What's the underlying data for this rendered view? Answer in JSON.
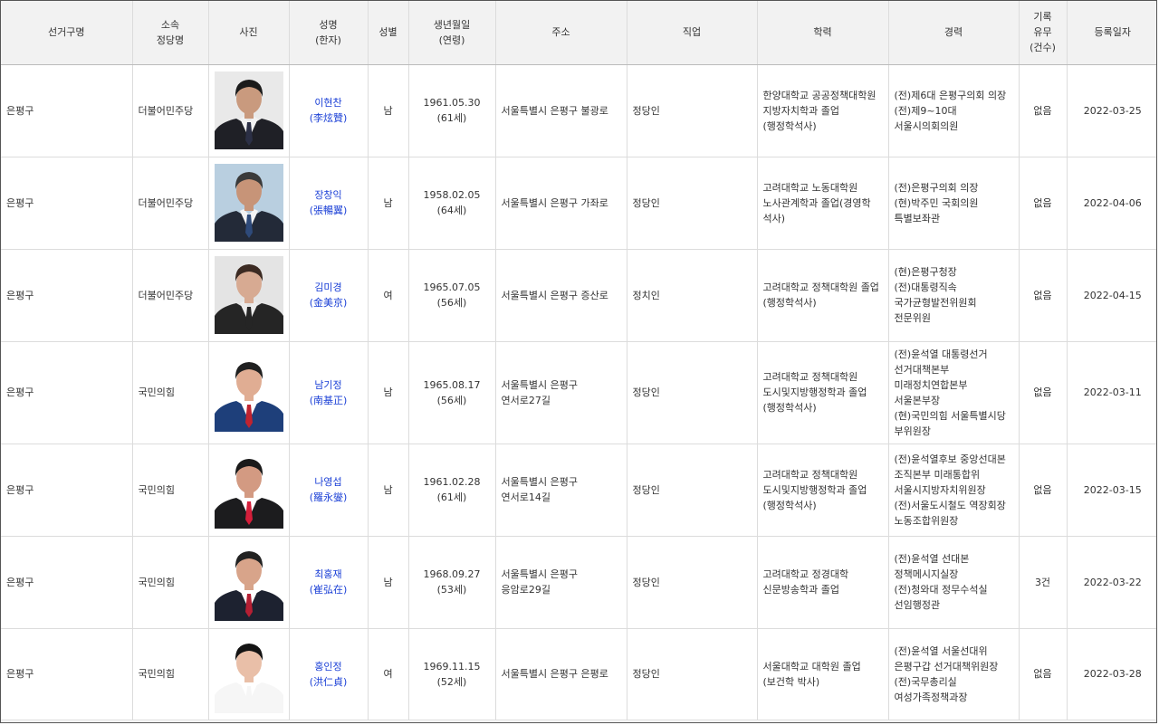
{
  "headers": [
    "선거구명",
    "소속\n정당명",
    "사진",
    "성명\n(한자)",
    "성별",
    "생년월일\n(연령)",
    "주소",
    "직업",
    "학력",
    "경력",
    "기록\n유무\n(건수)",
    "등록일자"
  ],
  "rows": [
    {
      "district": "은평구",
      "party": "더불어민주당",
      "name": "이현찬",
      "hanja": "(李炫贊)",
      "gender": "남",
      "birth": "1961.05.30",
      "age": "(61세)",
      "address": "서울특별시 은평구 불광로",
      "job": "정당인",
      "education": "한양대학교 공공정책대학원\n지방자치학과 졸업\n(행정학석사)",
      "career": "(전)제6대 은평구의회 의장\n(전)제9~10대\n서울시의회의원",
      "record": "없음",
      "date": "2022-03-25",
      "photo": {
        "bg": "#e9e9e9",
        "hair": "#1b1b1b",
        "skin": "#c99a7e",
        "suit": "#1f2026",
        "shirt": "#f2f2f2",
        "tie": "#2b2f45"
      }
    },
    {
      "district": "은평구",
      "party": "더불어민주당",
      "name": "장창익",
      "hanja": "(張暢翼)",
      "gender": "남",
      "birth": "1958.02.05",
      "age": "(64세)",
      "address": "서울특별시 은평구 가좌로",
      "job": "정당인",
      "education": "고려대학교 노동대학원\n노사관계학과 졸업(경영학\n석사)",
      "career": "(전)은평구의회 의장\n(현)박주민 국회의원\n특별보좌관",
      "record": "없음",
      "date": "2022-04-06",
      "photo": {
        "bg": "#b9cfe0",
        "hair": "#3a3a3a",
        "skin": "#c79478",
        "suit": "#232a38",
        "shirt": "#f4f4f4",
        "tie": "#2e4a7a"
      }
    },
    {
      "district": "은평구",
      "party": "더불어민주당",
      "name": "김미경",
      "hanja": "(金美京)",
      "gender": "여",
      "birth": "1965.07.05",
      "age": "(56세)",
      "address": "서울특별시 은평구 증산로",
      "job": "정치인",
      "education": "고려대학교 정책대학원 졸업\n(행정학석사)",
      "career": "(현)은평구청장\n(전)대통령직속\n국가균형발전위원회\n전문위원",
      "record": "없음",
      "date": "2022-04-15",
      "photo": {
        "bg": "#e4e4e4",
        "hair": "#3b2a22",
        "skin": "#d7aa92",
        "suit": "#252525",
        "shirt": "#ececec",
        "tie": "#252525"
      }
    },
    {
      "district": "은평구",
      "party": "국민의힘",
      "name": "남기정",
      "hanja": "(南基正)",
      "gender": "남",
      "birth": "1965.08.17",
      "age": "(56세)",
      "address": "서울특별시 은평구\n연서로27길",
      "job": "정당인",
      "education": "고려대학교 정책대학원\n도시및지방행정학과 졸업\n(행정학석사)",
      "career": "(전)윤석열 대통령선거\n선거대책본부\n미래정치연합본부\n서울본부장\n(현)국민의힘 서울특별시당\n부위원장",
      "record": "없음",
      "date": "2022-03-11",
      "photo": {
        "bg": "#ffffff",
        "hair": "#202020",
        "skin": "#e0ad93",
        "suit": "#1e3f7a",
        "shirt": "#ffffff",
        "tie": "#c0232f"
      }
    },
    {
      "district": "은평구",
      "party": "국민의힘",
      "name": "나영섭",
      "hanja": "(羅永燮)",
      "gender": "남",
      "birth": "1961.02.28",
      "age": "(61세)",
      "address": "서울특별시 은평구\n연서로14길",
      "job": "정당인",
      "education": "고려대학교 정책대학원\n도시및지방행정학과 졸업\n(행정학석사)",
      "career": "(전)윤석열후보 중앙선대본\n조직본부 미래통합위\n서울시지방자치위원장\n(전)서울도시철도 역장회장\n노동조합위원장",
      "record": "없음",
      "date": "2022-03-15",
      "photo": {
        "bg": "#ffffff",
        "hair": "#1a1a1a",
        "skin": "#d39a82",
        "suit": "#1c1c1e",
        "shirt": "#ffffff",
        "tie": "#d41e3a"
      }
    },
    {
      "district": "은평구",
      "party": "국민의힘",
      "name": "최홍재",
      "hanja": "(崔弘在)",
      "gender": "남",
      "birth": "1968.09.27",
      "age": "(53세)",
      "address": "서울특별시 은평구\n응암로29길",
      "job": "정당인",
      "education": "고려대학교 정경대학\n신문방송학과 졸업",
      "career": "(전)윤석열 선대본\n정책메시지실장\n(전)청와대 정무수석실\n선임행정관",
      "record": "3건",
      "date": "2022-03-22",
      "photo": {
        "bg": "#ffffff",
        "hair": "#222222",
        "skin": "#d8a48a",
        "suit": "#1d2230",
        "shirt": "#ffffff",
        "tie": "#b51f33"
      }
    },
    {
      "district": "은평구",
      "party": "국민의힘",
      "name": "홍인정",
      "hanja": "(洪仁貞)",
      "gender": "여",
      "birth": "1969.11.15",
      "age": "(52세)",
      "address": "서울특별시 은평구 은평로",
      "job": "정당인",
      "education": "서울대학교 대학원 졸업\n(보건학 박사)",
      "career": "(전)윤석열 서울선대위\n은평구갑 선거대책위원장\n(전)국무총리실\n여성가족정책과장",
      "record": "없음",
      "date": "2022-03-28",
      "photo": {
        "bg": "#ffffff",
        "hair": "#141414",
        "skin": "#e9bfa8",
        "suit": "#f6f6f6",
        "shirt": "#ffffff",
        "tie": "#f6f6f6"
      }
    }
  ]
}
